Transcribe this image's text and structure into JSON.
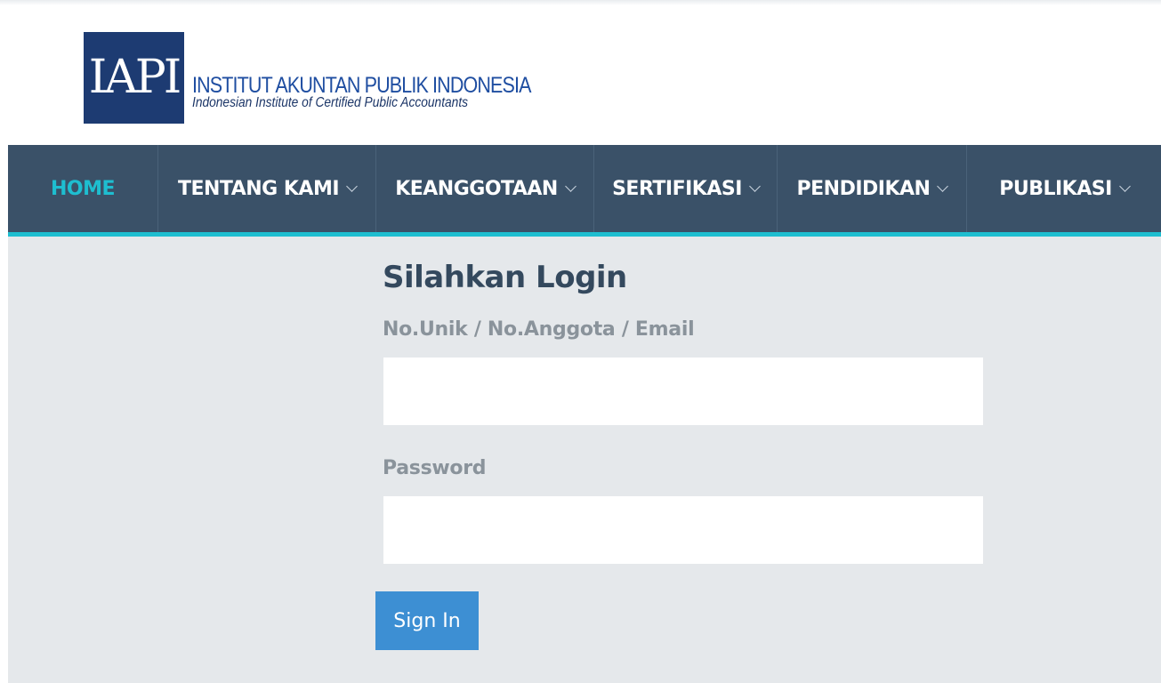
{
  "logo": {
    "mark": "IAPI",
    "title": "INSTITUT AKUNTAN PUBLIK INDONESIA",
    "subtitle": "Indonesian Institute of Certified Public Accountants",
    "brand_color": "#1d3b72"
  },
  "nav": {
    "background": "#3a5168",
    "accent": "#1ebed0",
    "items": [
      {
        "label": "HOME",
        "active": true,
        "has_dropdown": false
      },
      {
        "label": "TENTANG KAMI",
        "active": false,
        "has_dropdown": true,
        "icon": "chevron-down-icon"
      },
      {
        "label": "KEANGGOTAAN",
        "active": false,
        "has_dropdown": true,
        "icon": "chevron-down-icon"
      },
      {
        "label": "SERTIFIKASI",
        "active": false,
        "has_dropdown": true,
        "icon": "chevron-down-icon"
      },
      {
        "label": "PENDIDIKAN",
        "active": false,
        "has_dropdown": true,
        "icon": "chevron-down-icon"
      },
      {
        "label": "PUBLIKASI",
        "active": false,
        "has_dropdown": true,
        "icon": "chevron-down-icon"
      }
    ]
  },
  "login": {
    "title": "Silahkan Login",
    "username_label": "No.Unik / No.Anggota / Email",
    "username_value": "",
    "password_label": "Password",
    "password_value": "",
    "submit_label": "Sign In",
    "submit_color": "#3d8fd3"
  }
}
